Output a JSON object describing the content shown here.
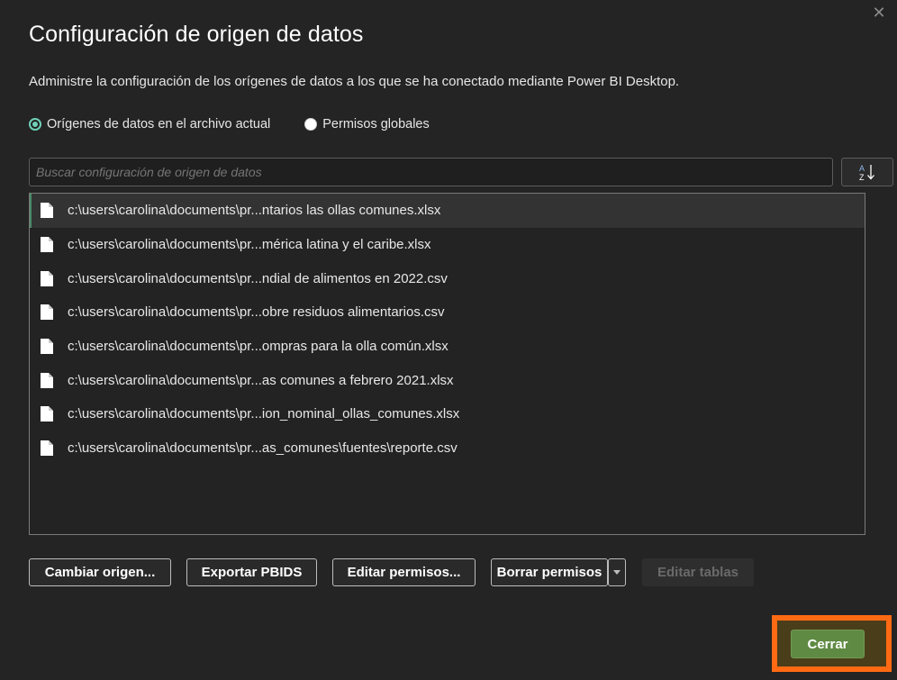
{
  "dialog": {
    "title": "Configuración de origen de datos",
    "subtitle": "Administre la configuración de los orígenes de datos a los que se ha conectado mediante Power BI Desktop.",
    "close_icon": "close-icon"
  },
  "scope": {
    "options": [
      {
        "label": "Orígenes de datos en el archivo actual",
        "checked": true
      },
      {
        "label": "Permisos globales",
        "checked": false
      }
    ]
  },
  "search": {
    "placeholder": "Buscar configuración de origen de datos",
    "value": ""
  },
  "sort_icon": "sort-az-icon",
  "sources": [
    {
      "path": "c:\\users\\carolina\\documents\\pr...ntarios las ollas comunes.xlsx",
      "selected": true
    },
    {
      "path": "c:\\users\\carolina\\documents\\pr...mérica latina y el caribe.xlsx",
      "selected": false
    },
    {
      "path": "c:\\users\\carolina\\documents\\pr...ndial de alimentos en 2022.csv",
      "selected": false
    },
    {
      "path": "c:\\users\\carolina\\documents\\pr...obre residuos alimentarios.csv",
      "selected": false
    },
    {
      "path": "c:\\users\\carolina\\documents\\pr...ompras para la olla común.xlsx",
      "selected": false
    },
    {
      "path": "c:\\users\\carolina\\documents\\pr...as comunes a febrero 2021.xlsx",
      "selected": false
    },
    {
      "path": "c:\\users\\carolina\\documents\\pr...ion_nominal_ollas_comunes.xlsx",
      "selected": false
    },
    {
      "path": "c:\\users\\carolina\\documents\\pr...as_comunes\\fuentes\\reporte.csv",
      "selected": false
    }
  ],
  "actions": {
    "change_source": "Cambiar origen...",
    "export_pbids": "Exportar PBIDS",
    "edit_permissions": "Editar permisos...",
    "clear_permissions": "Borrar permisos",
    "edit_tables": "Editar tablas"
  },
  "footer": {
    "close_label": "Cerrar"
  },
  "colors": {
    "background": "#242424",
    "accent_radio": "#6fd1b8",
    "primary_button": "#5f8a43",
    "highlight": "#ff6a13"
  }
}
